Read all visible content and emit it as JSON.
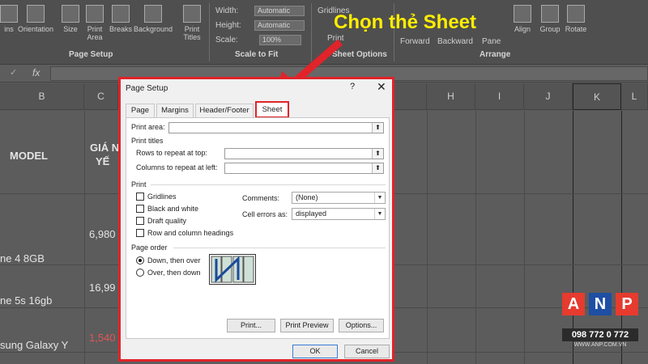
{
  "ribbon": {
    "buttons": [
      {
        "label": "ins"
      },
      {
        "label": "Orientation"
      },
      {
        "label": "Size"
      },
      {
        "label": "Print Area"
      },
      {
        "label": "Breaks"
      },
      {
        "label": "Background"
      },
      {
        "label": "Print Titles"
      }
    ],
    "page_setup_label": "Page Setup",
    "scale_to_fit": {
      "width_label": "Width:",
      "width_value": "Automatic",
      "height_label": "Height:",
      "height_value": "Automatic",
      "scale_label": "Scale:",
      "scale_value": "100%",
      "group_label": "Scale to Fit"
    },
    "sheet_options": {
      "gridlines": "Gridlines",
      "print": "Print",
      "group_label": "Sheet Options"
    },
    "arrange": {
      "forward": "Forward",
      "backward": "Backward",
      "pane": "Pane",
      "align": "Align",
      "group": "Group",
      "rotate": "Rotate",
      "group_label": "Arrange"
    }
  },
  "formula_bar": {
    "cancel_icon": "✓",
    "fx": "fx"
  },
  "columns": [
    "B",
    "C",
    "H",
    "I",
    "J",
    "K",
    "L"
  ],
  "cells": {
    "model_header": "MODEL",
    "price_header_line1": "GIÁ N",
    "price_header_line2": "YẾ",
    "row1_name": "ne 4 8GB",
    "row1_price": "6,980",
    "row2_name": "ne 5s 16gb",
    "row2_price": "16,99",
    "row3_name": "sung Galaxy Y",
    "row3_price": "1,540"
  },
  "annotation": "Chọn thẻ Sheet",
  "dialog": {
    "title": "Page Setup",
    "help": "?",
    "close": "✕",
    "tabs": [
      "Page",
      "Margins",
      "Header/Footer",
      "Sheet"
    ],
    "print_area_label": "Print area:",
    "print_titles_label": "Print titles",
    "rows_repeat_label": "Rows to repeat at top:",
    "cols_repeat_label": "Columns to repeat at left:",
    "print_section_label": "Print",
    "gridlines_label": "Gridlines",
    "bw_label": "Black and white",
    "draft_label": "Draft quality",
    "headings_label": "Row and column headings",
    "comments_label": "Comments:",
    "comments_value": "(None)",
    "cell_errors_label": "Cell errors as:",
    "cell_errors_value": "displayed",
    "page_order_label": "Page order",
    "down_over_label": "Down, then over",
    "over_down_label": "Over, then down",
    "print_btn": "Print...",
    "preview_btn": "Print Preview",
    "options_btn": "Options...",
    "ok_btn": "OK",
    "cancel_btn": "Cancel"
  },
  "logo": {
    "a": "A",
    "n": "N",
    "p": "P",
    "phone": "098 772 0 772",
    "website": "WWW.ANP.COM.VN",
    "colors": {
      "a": "#e63b2e",
      "n": "#1e4fa3",
      "p": "#e63b2e"
    }
  }
}
